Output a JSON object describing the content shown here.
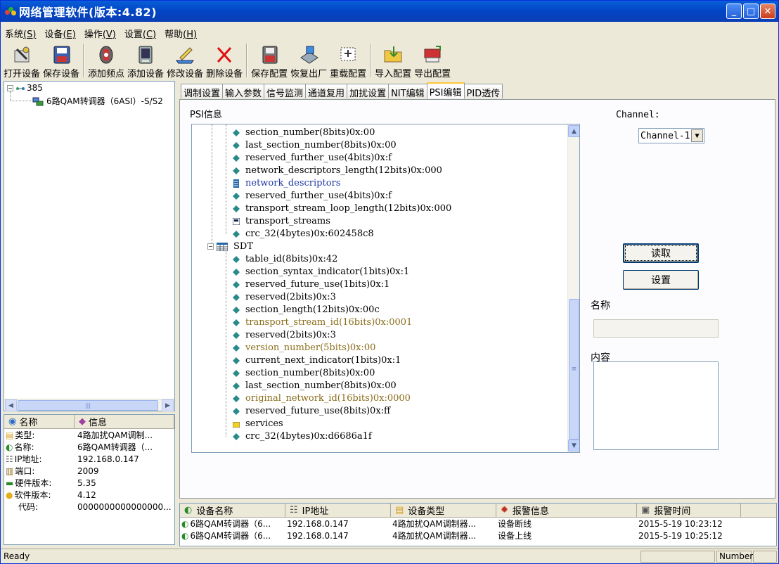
{
  "window": {
    "title": "网络管理软件(版本:4.82)",
    "ctrl_min": "_",
    "ctrl_max": "□",
    "ctrl_close": "✕"
  },
  "menu": [
    {
      "label": "系统",
      "key": "(S)"
    },
    {
      "label": "设备",
      "key": "(E)"
    },
    {
      "label": "操作",
      "key": "(V)"
    },
    {
      "label": "设置",
      "key": "(C)"
    },
    {
      "label": "帮助",
      "key": "(H)"
    }
  ],
  "toolbar": {
    "open_device": "打开设备",
    "save_device": "保存设备",
    "add_freq": "添加频点",
    "add_device": "添加设备",
    "edit_device": "修改设备",
    "delete_device": "删除设备",
    "save_config": "保存配置",
    "factory_reset": "恢复出厂",
    "reload_config": "重载配置",
    "import_config": "导入配置",
    "export_config": "导出配置"
  },
  "tree": {
    "root_label": "385",
    "child_label": "6路QAM转调器（6ASI）-S/S2"
  },
  "info": {
    "col_name": "名称",
    "col_info": "信息",
    "rows": [
      {
        "k": "类型:",
        "v": "4路加扰QAM调制..."
      },
      {
        "k": "名称:",
        "v": "6路QAM转调器（..."
      },
      {
        "k": "IP地址:",
        "v": "192.168.0.147"
      },
      {
        "k": "端口:",
        "v": "2009"
      },
      {
        "k": "硬件版本:",
        "v": "5.35"
      },
      {
        "k": "软件版本:",
        "v": "4.12"
      },
      {
        "k": "代码:",
        "v": "0000000000000000..."
      }
    ]
  },
  "tabs": [
    "调制设置",
    "输入参数",
    "信号监测",
    "通道复用",
    "加扰设置",
    "NIT编辑",
    "PSI编辑",
    "PID透传"
  ],
  "active_tab": "PSI编辑",
  "psi": {
    "title": "PSI信息",
    "nodes": [
      {
        "text": "section_number(8bits)0x:00",
        "kind": "field"
      },
      {
        "text": "last_section_number(8bits)0x:00",
        "kind": "field"
      },
      {
        "text": "reserved_further_use(4bits)0x:f",
        "kind": "field"
      },
      {
        "text": "network_descriptors_length(12bits)0x:000",
        "kind": "field"
      },
      {
        "text": "network_descriptors",
        "kind": "list"
      },
      {
        "text": "reserved_further_use(4bits)0x:f",
        "kind": "field"
      },
      {
        "text": "transport_stream_loop_length(12bits)0x:000",
        "kind": "field"
      },
      {
        "text": "transport_streams",
        "kind": "stream"
      },
      {
        "text": "crc_32(4bytes)0x:602458c8",
        "kind": "field"
      },
      {
        "text": "SDT",
        "kind": "table"
      },
      {
        "text": "table_id(8bits)0x:42",
        "kind": "field"
      },
      {
        "text": "section_syntax_indicator(1bits)0x:1",
        "kind": "field"
      },
      {
        "text": "reserved_future_use(1bits)0x:1",
        "kind": "field"
      },
      {
        "text": "reserved(2bits)0x:3",
        "kind": "field"
      },
      {
        "text": "section_length(12bits)0x:00c",
        "kind": "field"
      },
      {
        "text": "transport_stream_id(16bits)0x:0001",
        "kind": "editable"
      },
      {
        "text": "reserved(2bits)0x:3",
        "kind": "field"
      },
      {
        "text": "version_number(5bits)0x:00",
        "kind": "editable"
      },
      {
        "text": "current_next_indicator(1bits)0x:1",
        "kind": "field"
      },
      {
        "text": "section_number(8bits)0x:00",
        "kind": "field"
      },
      {
        "text": "last_section_number(8bits)0x:00",
        "kind": "field"
      },
      {
        "text": "original_network_id(16bits)0x:0000",
        "kind": "editable"
      },
      {
        "text": "reserved_future_use(8bits)0x:ff",
        "kind": "field"
      },
      {
        "text": "services",
        "kind": "services"
      },
      {
        "text": "crc_32(4bytes)0x:d6686a1f",
        "kind": "field"
      }
    ]
  },
  "side": {
    "channel_label": "Channel:",
    "channel_value": "Channel-1",
    "read_button": "读取",
    "set_button": "设置",
    "name_label": "名称",
    "content_label": "内容"
  },
  "alarm": {
    "headers": [
      "设备名称",
      "IP地址",
      "设备类型",
      "报警信息",
      "报警时间"
    ],
    "rows": [
      [
        "6路QAM转调器（6...",
        "192.168.0.147",
        "4路加扰QAM调制器...",
        "设备断线",
        "2015-5-19 10:23:12"
      ],
      [
        "6路QAM转调器（6...",
        "192.168.0.147",
        "4路加扰QAM调制器...",
        "设备上线",
        "2015-5-19 10:25:12"
      ]
    ]
  },
  "status": {
    "ready": "Ready",
    "number": "Number"
  },
  "colors": {
    "field_icon": "#2a8a8a",
    "editable_text": "#8a6d1a",
    "list_text": "#1f3aa6"
  }
}
